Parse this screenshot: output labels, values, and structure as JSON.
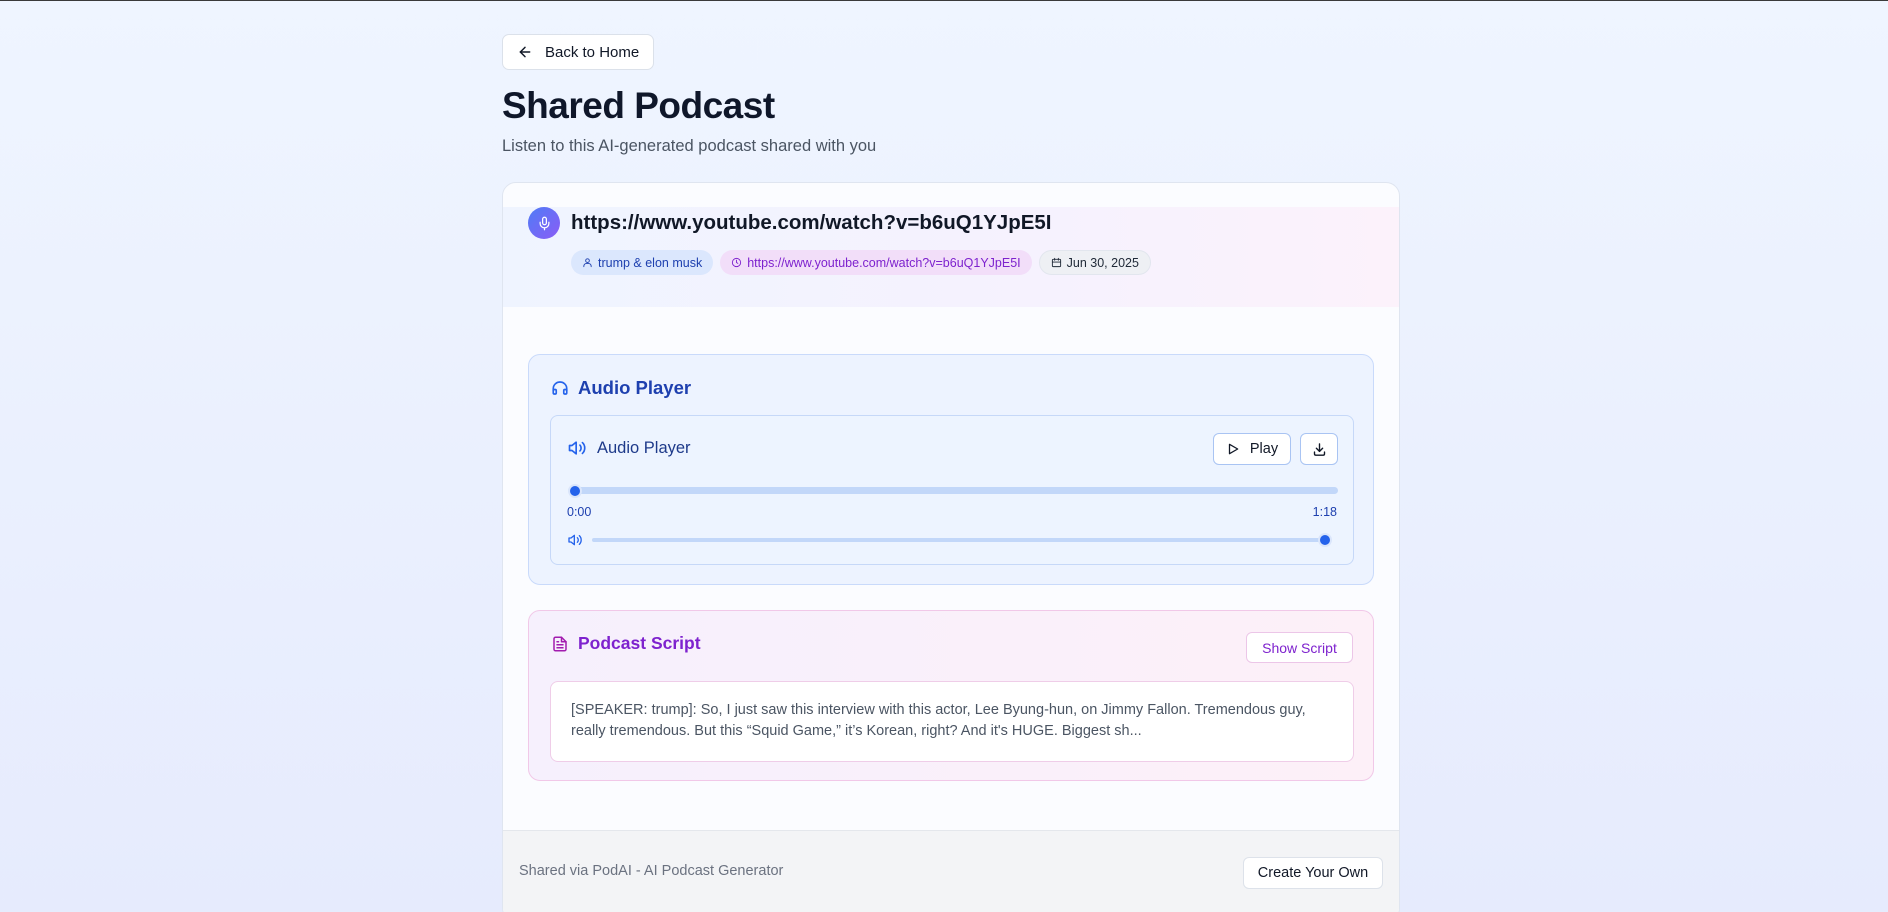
{
  "nav": {
    "back_label": "Back to Home"
  },
  "page": {
    "title": "Shared Podcast",
    "subtitle": "Listen to this AI-generated podcast shared with you"
  },
  "podcast": {
    "title": "https://www.youtube.com/watch?v=b6uQ1YJpE5I",
    "tags": {
      "speakers": "trump & elon musk",
      "source": "https://www.youtube.com/watch?v=b6uQ1YJpE5I",
      "date": "Jun 30, 2025"
    }
  },
  "audio_player": {
    "section_title": "Audio Player",
    "inner_title": "Audio Player",
    "play_label": "Play",
    "current_time": "0:00",
    "total_time": "1:18",
    "progress": 0,
    "volume": 1
  },
  "script": {
    "section_title": "Podcast Script",
    "show_label": "Show Script",
    "preview": "[SPEAKER: trump]: So, I just saw this interview with this actor, Lee Byung-hun, on Jimmy Fallon. Tremendous guy, really tremendous. But this “Squid Game,” it’s Korean, right? And it's HUGE. Biggest sh..."
  },
  "footer": {
    "text": "Shared via PodAI - AI Podcast Generator",
    "create_label": "Create Your Own"
  },
  "icons": {
    "back": "arrow-left-icon",
    "mic": "mic-icon",
    "speakers": "user-icon",
    "source": "clock-icon",
    "date": "calendar-icon",
    "headphones": "headphones-icon",
    "volume": "volume-icon",
    "play": "play-icon",
    "download": "download-icon",
    "script": "file-text-icon"
  },
  "colors": {
    "accent_blue": "#2563eb",
    "accent_purple": "#7e22ce",
    "title_dark": "#0f172a"
  }
}
